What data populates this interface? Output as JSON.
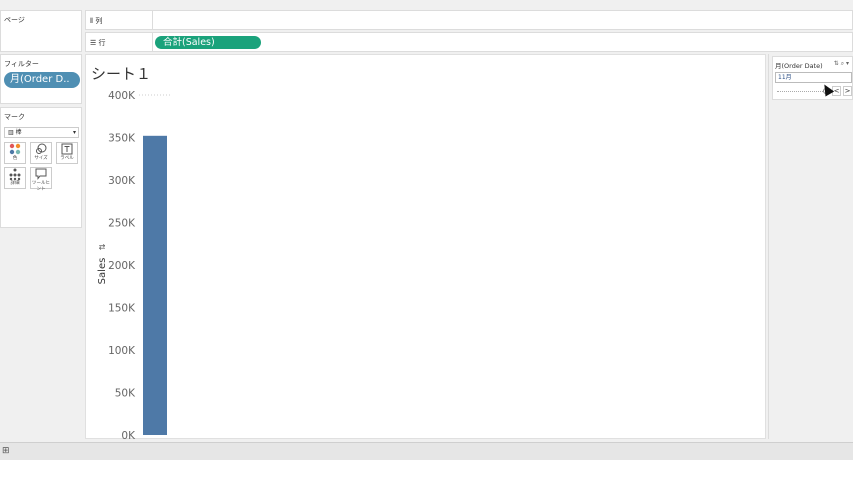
{
  "pages_panel": {
    "title": "ページ"
  },
  "filters_panel": {
    "title": "フィルター",
    "pill": "月(Order D.."
  },
  "marks_panel": {
    "title": "マーク",
    "type": "棒",
    "buttons": [
      {
        "label": "色",
        "icon": "color-dots-icon"
      },
      {
        "label": "サイズ",
        "icon": "size-icon"
      },
      {
        "label": "ラベル",
        "icon": "label-icon"
      },
      {
        "label": "詳細",
        "icon": "detail-icon"
      },
      {
        "label": "ツールヒント",
        "icon": "tooltip-icon"
      }
    ]
  },
  "shelves": {
    "columns": {
      "label": "列"
    },
    "rows": {
      "label": "行",
      "pill": "合計(Sales)"
    }
  },
  "sheet": {
    "title": "シート１"
  },
  "quick_filter": {
    "title": "月(Order Date)",
    "value": "11月",
    "prev": "<",
    "next": ">"
  },
  "colors": {
    "bar": "#4e79a7",
    "row_pill": "#1aa27b",
    "filter_pill": "#4f8fb3"
  },
  "chart_data": {
    "type": "bar",
    "categories": [
      ""
    ],
    "values": [
      352000
    ],
    "ylabel": "Sales",
    "ylim": [
      0,
      400000
    ],
    "yticks": [
      0,
      50000,
      100000,
      150000,
      200000,
      250000,
      300000,
      350000,
      400000
    ],
    "ytick_labels": [
      "0K",
      "50K",
      "100K",
      "150K",
      "200K",
      "250K",
      "300K",
      "350K",
      "400K"
    ],
    "grid": false
  }
}
